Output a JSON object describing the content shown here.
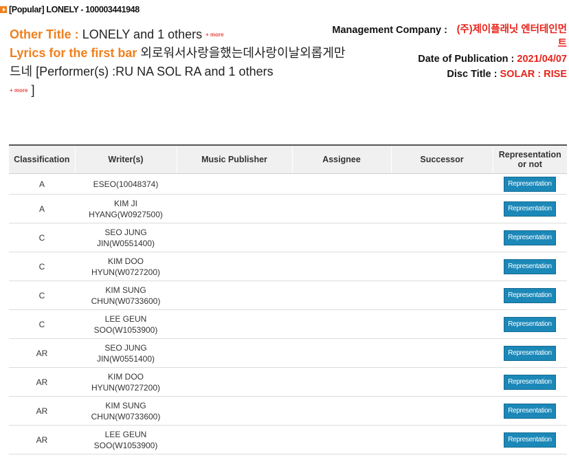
{
  "header": {
    "song_title": "[Popular] LONELY - 100003441948"
  },
  "info": {
    "other_title_label": "Other Title : ",
    "other_title_value": "LONELY and 1 others ",
    "more_label": "+ more",
    "lyrics_label": "Lyrics for the first bar ",
    "lyrics_value": "외로워서사랑을했는데사랑이날외롭게만드네",
    "performer_text": " [Performer(s) :RU NA SOL RA and 1 others",
    "close_bracket": "]",
    "management_label": "Management Company : ",
    "management_value": "(주)제이플래닛 엔터테인먼트",
    "publication_label": "Date of Publication : ",
    "publication_value": "2021/04/07",
    "disc_label": "Disc Title : ",
    "disc_value": "SOLAR : RISE"
  },
  "table": {
    "headers": [
      "Classification",
      "Writer(s)",
      "Music Publisher",
      "Assignee",
      "Successor",
      "Representation or not"
    ],
    "button_label": "Representation",
    "rows": [
      {
        "classification": "A",
        "writer": "ESEO(10048374)",
        "publisher": "",
        "assignee": "",
        "successor": ""
      },
      {
        "classification": "A",
        "writer": "KIM JI HYANG(W0927500)",
        "publisher": "",
        "assignee": "",
        "successor": ""
      },
      {
        "classification": "C",
        "writer": "SEO JUNG JIN(W0551400)",
        "publisher": "",
        "assignee": "",
        "successor": ""
      },
      {
        "classification": "C",
        "writer": "KIM DOO HYUN(W0727200)",
        "publisher": "",
        "assignee": "",
        "successor": ""
      },
      {
        "classification": "C",
        "writer": "KIM SUNG CHUN(W0733600)",
        "publisher": "",
        "assignee": "",
        "successor": ""
      },
      {
        "classification": "C",
        "writer": "LEE GEUN SOO(W1053900)",
        "publisher": "",
        "assignee": "",
        "successor": ""
      },
      {
        "classification": "AR",
        "writer": "SEO JUNG JIN(W0551400)",
        "publisher": "",
        "assignee": "",
        "successor": ""
      },
      {
        "classification": "AR",
        "writer": "KIM DOO HYUN(W0727200)",
        "publisher": "",
        "assignee": "",
        "successor": ""
      },
      {
        "classification": "AR",
        "writer": "KIM SUNG CHUN(W0733600)",
        "publisher": "",
        "assignee": "",
        "successor": ""
      },
      {
        "classification": "AR",
        "writer": "LEE GEUN SOO(W1053900)",
        "publisher": "",
        "assignee": "",
        "successor": ""
      }
    ]
  },
  "colors": {
    "accent_orange": "#f07f1c",
    "value_red": "#e8231a",
    "button_blue": "#1b88b8"
  }
}
